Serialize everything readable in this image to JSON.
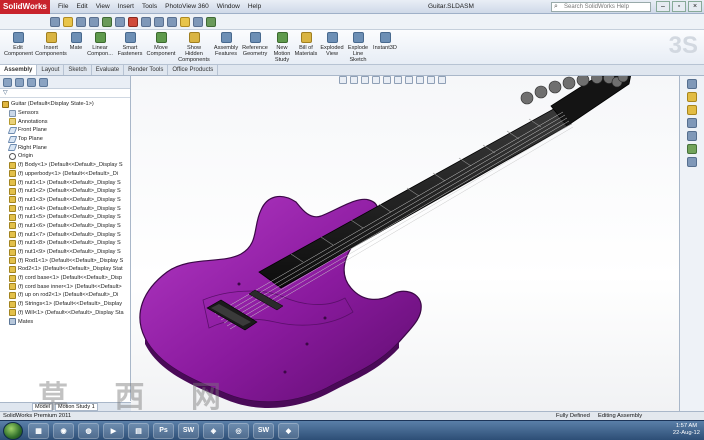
{
  "titlebar": {
    "app_logo": "SolidWorks",
    "menu": [
      "File",
      "Edit",
      "View",
      "Insert",
      "Tools",
      "PhotoView 360",
      "Window",
      "Help"
    ],
    "document_title": "Guitar.SLDASM",
    "search_placeholder": "Search SolidWorks Help"
  },
  "ribbon": {
    "items": [
      {
        "label": "Edit Component",
        "icon": "edit-component-icon"
      },
      {
        "label": "Insert Components",
        "icon": "insert-components-icon"
      },
      {
        "label": "Mate",
        "icon": "mate-icon"
      },
      {
        "label": "Linear Compon...",
        "icon": "linear-pattern-icon"
      },
      {
        "label": "Smart Fasteners",
        "icon": "smart-fasteners-icon"
      },
      {
        "label": "Move Component",
        "icon": "move-component-icon"
      },
      {
        "label": "Show Hidden Components",
        "icon": "show-hidden-icon"
      },
      {
        "label": "Assembly Features",
        "icon": "assembly-features-icon"
      },
      {
        "label": "Reference Geometry",
        "icon": "reference-geometry-icon"
      },
      {
        "label": "New Motion Study",
        "icon": "motion-study-icon"
      },
      {
        "label": "Bill of Materials",
        "icon": "bom-icon"
      },
      {
        "label": "Exploded View",
        "icon": "exploded-view-icon"
      },
      {
        "label": "Explode Line Sketch",
        "icon": "explode-line-icon"
      },
      {
        "label": "Instant3D",
        "icon": "instant3d-icon"
      }
    ]
  },
  "tabs": [
    "Assembly",
    "Layout",
    "Sketch",
    "Evaluate",
    "Render Tools",
    "Office Products"
  ],
  "tree": {
    "root": "Guitar  (Default<Display State-1>)",
    "items": [
      {
        "label": "Sensors",
        "icon": "sensors-icon"
      },
      {
        "label": "Annotations",
        "icon": "annotations-icon"
      },
      {
        "label": "Front Plane",
        "icon": "plane-icon"
      },
      {
        "label": "Top Plane",
        "icon": "plane-icon"
      },
      {
        "label": "Right Plane",
        "icon": "plane-icon"
      },
      {
        "label": "Origin",
        "icon": "origin-icon"
      },
      {
        "label": "(f) Body<1> (Default<<Default>_Display S",
        "icon": "part-icon"
      },
      {
        "label": "(f) upperbody<1> (Default<<Default>_Di",
        "icon": "part-icon"
      },
      {
        "label": "(f) nut1<1> (Default<<Default>_Display S",
        "icon": "part-icon"
      },
      {
        "label": "(f) nut1<2> (Default<<Default>_Display S",
        "icon": "part-icon"
      },
      {
        "label": "(f) nut1<3> (Default<<Default>_Display S",
        "icon": "part-icon"
      },
      {
        "label": "(f) nut1<4> (Default<<Default>_Display S",
        "icon": "part-icon"
      },
      {
        "label": "(f) nut1<5> (Default<<Default>_Display S",
        "icon": "part-icon"
      },
      {
        "label": "(f) nut1<6> (Default<<Default>_Display S",
        "icon": "part-icon"
      },
      {
        "label": "(f) nut1<7> (Default<<Default>_Display S",
        "icon": "part-icon"
      },
      {
        "label": "(f) nut1<8> (Default<<Default>_Display S",
        "icon": "part-icon"
      },
      {
        "label": "(f) nut1<9> (Default<<Default>_Display S",
        "icon": "part-icon"
      },
      {
        "label": "(f) Rod1<1> (Default<<Default>_Display S",
        "icon": "part-icon"
      },
      {
        "label": "Rod2<1> (Default<<Default>_Display Stat",
        "icon": "part-icon"
      },
      {
        "label": "(f) cord base<1> (Default<<Default>_Disp",
        "icon": "part-icon"
      },
      {
        "label": "(f) cord base inner<1> (Default<<Default>",
        "icon": "part-icon"
      },
      {
        "label": "(f) up on rod2<1> (Default<<Default>_Di",
        "icon": "part-icon"
      },
      {
        "label": "(f) Strings<1> (Default<<Default>_Display",
        "icon": "part-icon"
      },
      {
        "label": "(f) Will<1> (Default<<Default>_Display Sta",
        "icon": "part-icon"
      },
      {
        "label": "Mates",
        "icon": "mates-icon"
      }
    ]
  },
  "panel_bottom_tabs": [
    "Model",
    "Motion Study 1"
  ],
  "model": {
    "name": "Guitar",
    "body_color": "#8a1a9e",
    "neck_color": "#1a1a1a",
    "peg_count": 9
  },
  "statusbar": {
    "product": "SolidWorks Premium 2011",
    "definition": "Fully Defined",
    "mode": "Editing Assembly"
  },
  "taskbar": {
    "time": "1:57 AM",
    "date": "22-Aug-12"
  },
  "watermark": "草 西 网"
}
